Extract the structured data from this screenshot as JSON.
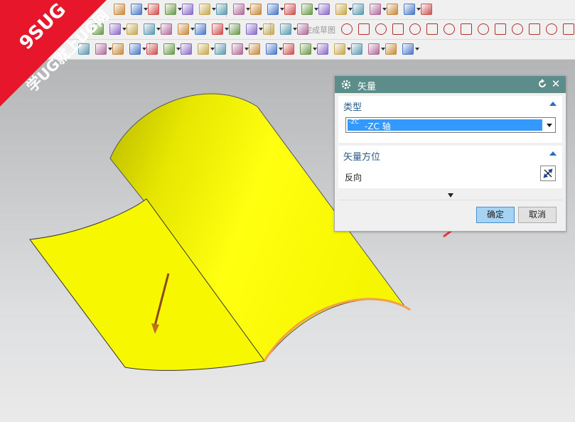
{
  "watermark": {
    "brand": "9SUG",
    "slogan": "学UG就上UG网"
  },
  "toolbar": {
    "finish_sketch_label": "完成草图"
  },
  "dialog": {
    "title": "矢量",
    "section_type": {
      "header": "类型",
      "icon_text": "-ZC",
      "selected_value": "-ZC 轴"
    },
    "section_orientation": {
      "header": "矢量方位",
      "reverse_label": "反向"
    },
    "ok_label": "确定",
    "cancel_label": "取消"
  },
  "colors": {
    "titlebar": "#5c8d8a",
    "surface": "#f5f500",
    "vector_arrow": "#8a4a1a",
    "highlight_edge": "#f0a050",
    "annotation_arrow": "#e83a3a"
  }
}
